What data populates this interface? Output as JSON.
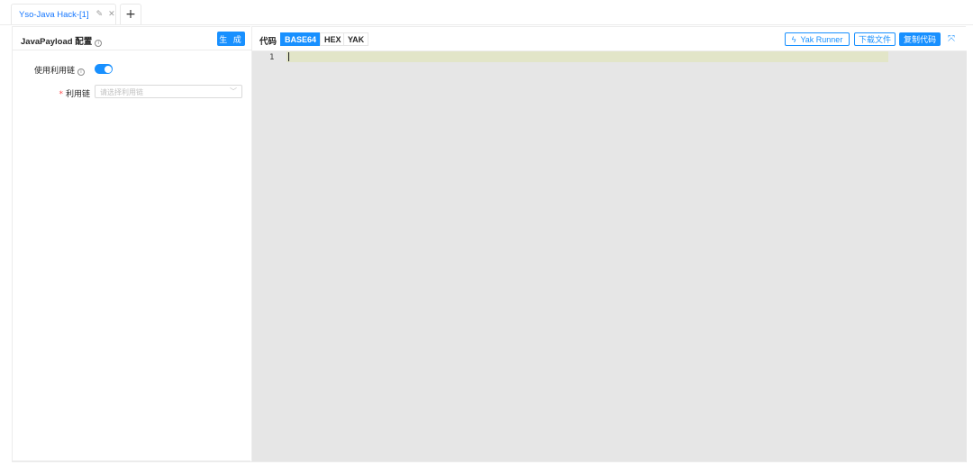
{
  "tabs": {
    "active": {
      "title": "Yso-Java Hack-[1]",
      "edit_icon": "edit-icon",
      "close_icon": "close-icon"
    },
    "add_label": "+"
  },
  "left": {
    "title": "JavaPayload 配置",
    "generate_label": "生 成",
    "use_chain_label": "使用利用链",
    "use_chain_enabled": true,
    "chain_label": "利用链",
    "chain_required": true,
    "chain_placeholder": "请选择利用链"
  },
  "right": {
    "code_label": "代码",
    "formats": [
      "BASE64",
      "HEX",
      "YAK"
    ],
    "selected_format": "BASE64",
    "yak_runner_label": "Yak Runner",
    "download_label": "下载文件",
    "copy_label": "复制代码",
    "line_numbers": [
      "1"
    ]
  },
  "colors": {
    "accent": "#1890ff",
    "editor_bg": "#e6e6e6",
    "line_highlight": "#e2e5c8",
    "required": "#ff4d4f"
  }
}
